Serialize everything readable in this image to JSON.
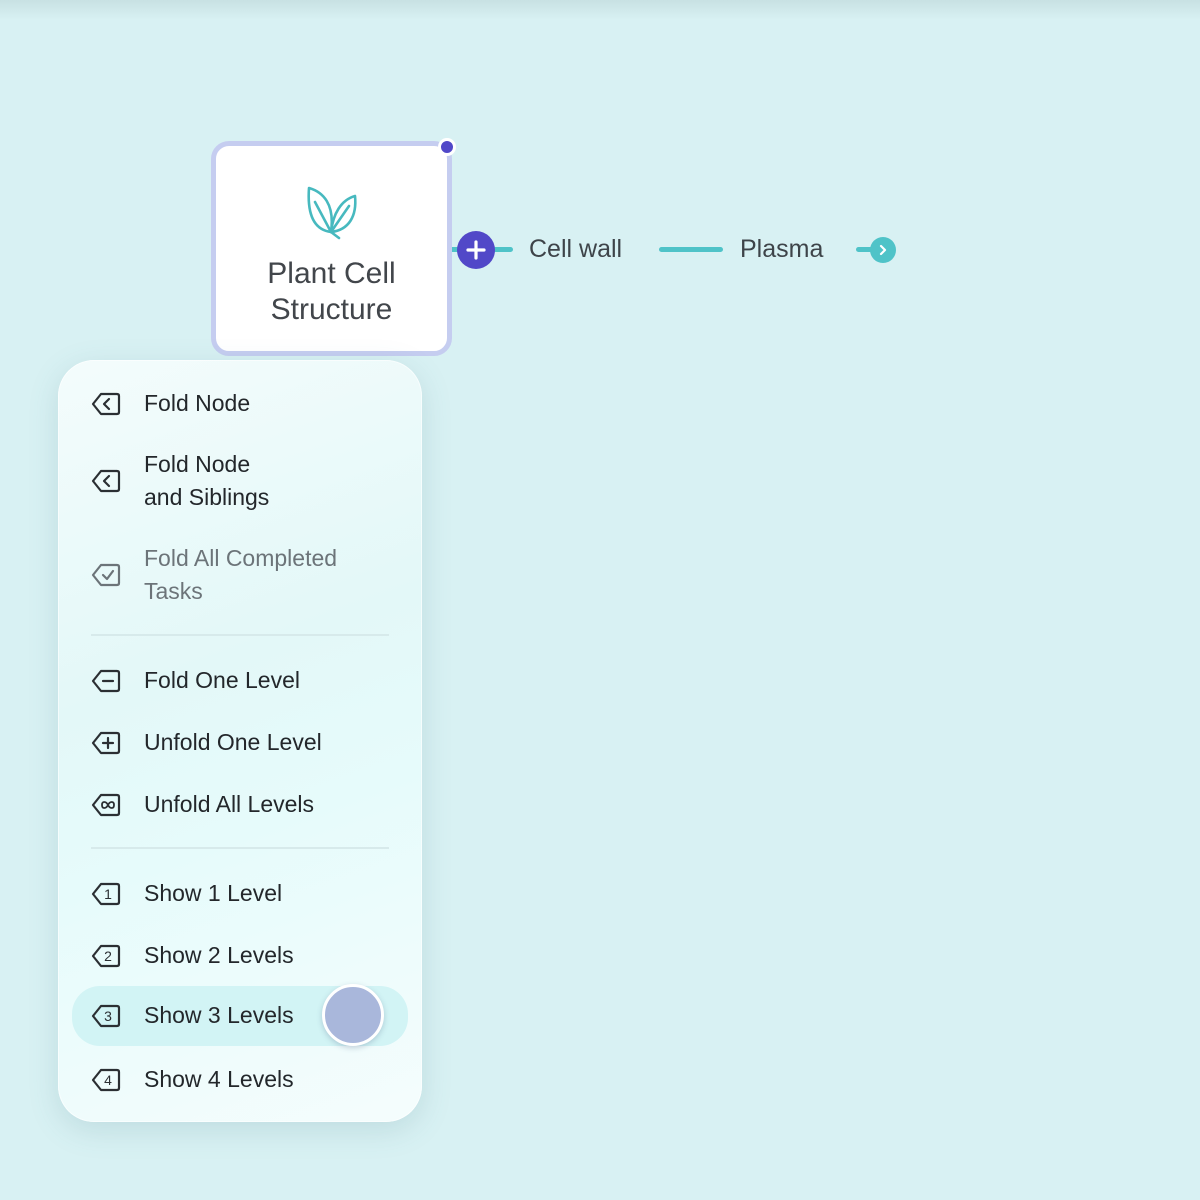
{
  "canvas": {
    "background_color": "#d8f1f3",
    "accent_color": "#5148c8",
    "connector_color": "#4fc3c8"
  },
  "central_node": {
    "icon": "leaf-icon",
    "title": "Plant Cell Structure"
  },
  "branches": [
    {
      "label": "Cell wall"
    },
    {
      "label": "Plasma"
    }
  ],
  "menu": {
    "groups": [
      [
        {
          "icon": "fold-node-icon",
          "label": "Fold Node",
          "enabled": true
        },
        {
          "icon": "fold-siblings-icon",
          "label": "Fold Node\nand Siblings",
          "enabled": true
        },
        {
          "icon": "check-fold-icon",
          "label": "Fold All Completed\nTasks",
          "enabled": false
        }
      ],
      [
        {
          "icon": "fold-level-icon",
          "label": "Fold One Level",
          "enabled": true
        },
        {
          "icon": "unfold-level-icon",
          "label": "Unfold One Level",
          "enabled": true
        },
        {
          "icon": "unfold-all-icon",
          "label": "Unfold All Levels",
          "enabled": true
        }
      ],
      [
        {
          "icon": "level-1-icon",
          "label": "Show 1 Level",
          "enabled": true
        },
        {
          "icon": "level-2-icon",
          "label": "Show 2 Levels",
          "enabled": true
        },
        {
          "icon": "level-3-icon",
          "label": "Show 3 Levels",
          "enabled": true,
          "highlighted": true
        },
        {
          "icon": "level-4-icon",
          "label": "Show 4 Levels",
          "enabled": true
        }
      ]
    ]
  }
}
